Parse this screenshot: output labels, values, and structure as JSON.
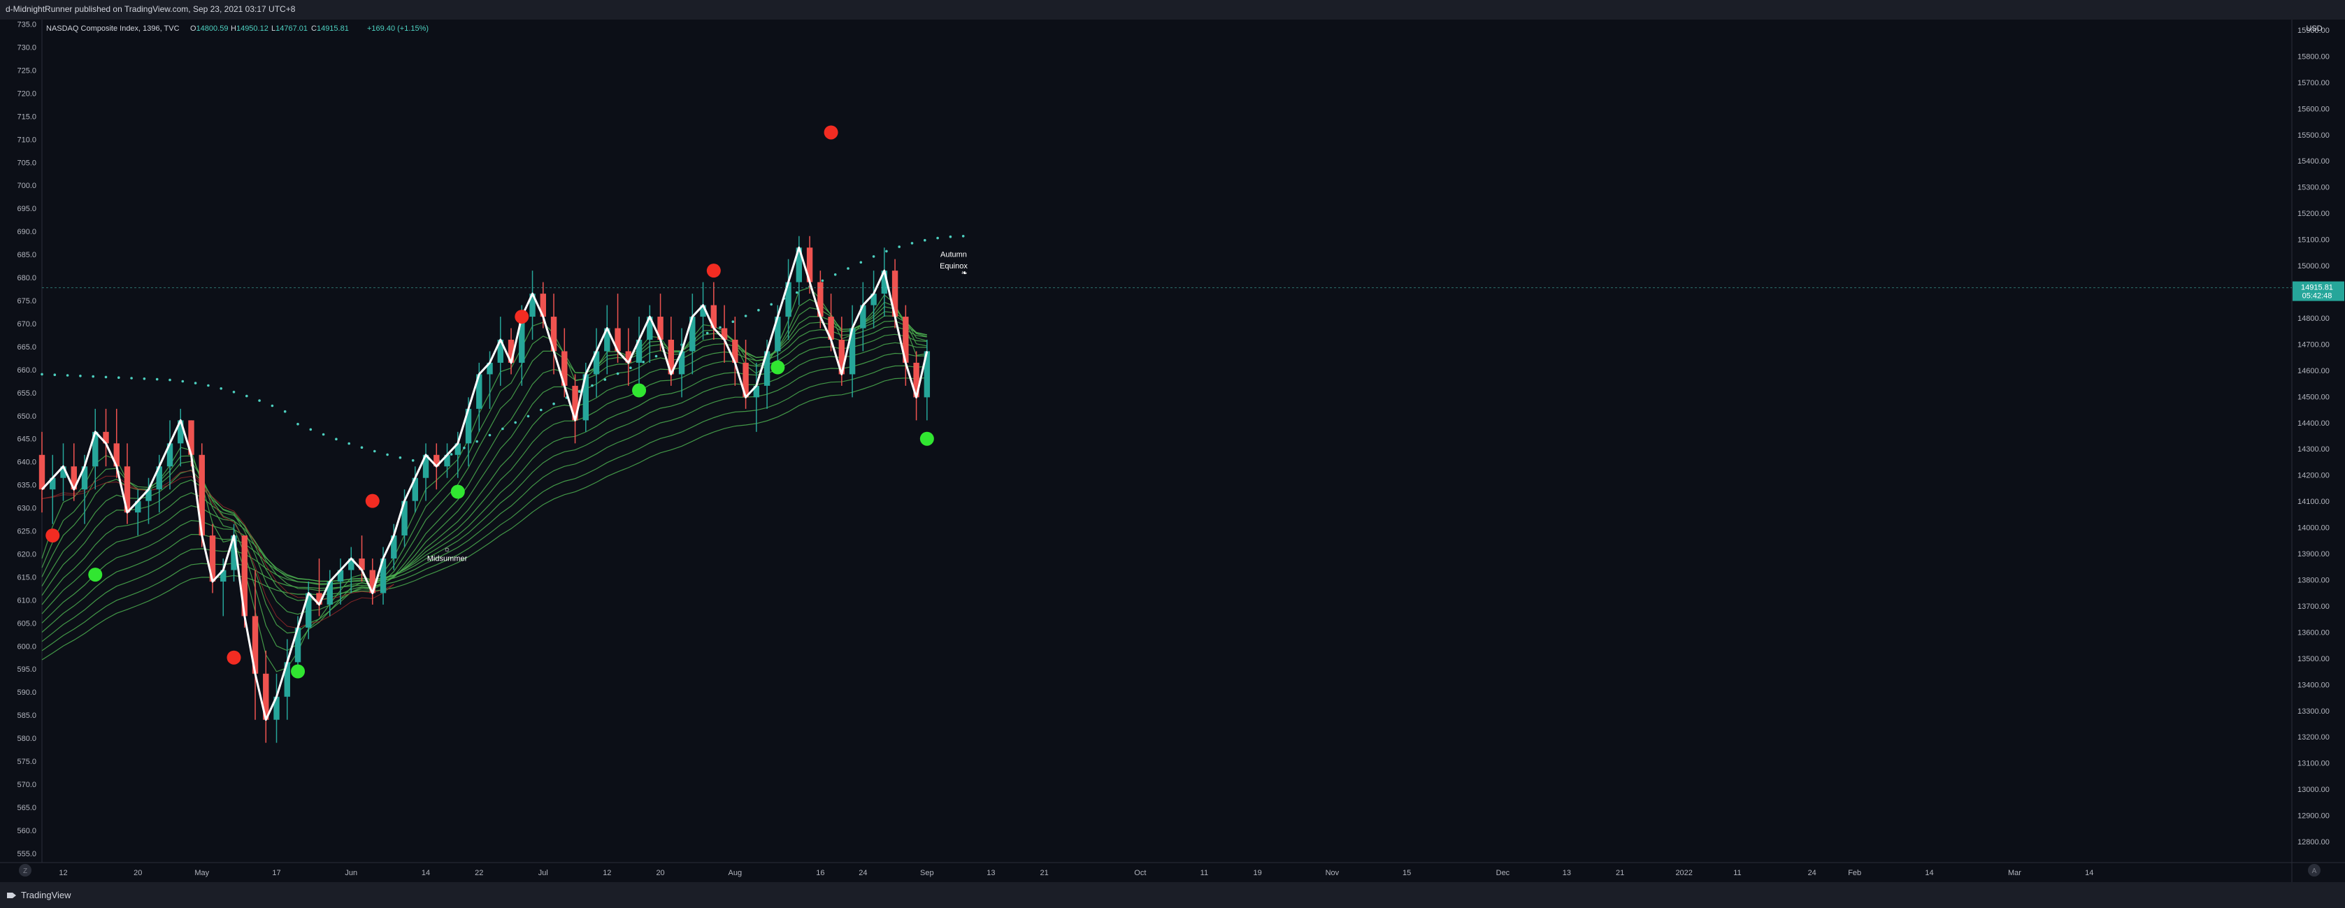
{
  "header": {
    "publisher": "d-MidnightRunner published on TradingView.com, Sep 23, 2021 03:17 UTC+8"
  },
  "legend": {
    "symbol": "NASDAQ Composite Index, 1396, TVC",
    "o_label": "O",
    "o": "14800.59",
    "h_label": "H",
    "h": "14950.12",
    "l_label": "L",
    "l": "14767.01",
    "c_label": "C",
    "c": "14915.81",
    "change": "+169.40 (+1.15%)"
  },
  "footer": {
    "brand": "TradingView"
  },
  "colors": {
    "bg": "#0c0f17",
    "up": "#26a69a",
    "down": "#ef5350",
    "ribbon": "#4caf50",
    "dot_green": "#31e631",
    "dot_red": "#f22c22",
    "accent": "#4dd0c0"
  },
  "chart_data": {
    "type": "line",
    "left_axis": {
      "ticks": [
        "735.0",
        "730.0",
        "725.0",
        "720.0",
        "715.0",
        "710.0",
        "705.0",
        "700.0",
        "695.0",
        "690.0",
        "685.0",
        "680.0",
        "675.0",
        "670.0",
        "665.0",
        "660.0",
        "655.0",
        "650.0",
        "645.0",
        "640.0",
        "635.0",
        "630.0",
        "625.0",
        "620.0",
        "615.0",
        "610.0",
        "605.0",
        "600.0",
        "595.0",
        "590.0",
        "585.0",
        "580.0",
        "575.0",
        "570.0",
        "565.0",
        "560.0",
        "555.0"
      ],
      "ylim": [
        553,
        736
      ]
    },
    "right_axis": {
      "unit": "USD",
      "ticks": [
        "15900.00",
        "15800.00",
        "15700.00",
        "15600.00",
        "15500.00",
        "15400.00",
        "15300.00",
        "15200.00",
        "15100.00",
        "15000.00",
        "14900.00",
        "14800.00",
        "14700.00",
        "14600.00",
        "14500.00",
        "14400.00",
        "14300.00",
        "14200.00",
        "14100.00",
        "14000.00",
        "13900.00",
        "13800.00",
        "13700.00",
        "13600.00",
        "13500.00",
        "13400.00",
        "13300.00",
        "13200.00",
        "13100.00",
        "13000.00",
        "12900.00",
        "12800.00"
      ],
      "ylim": [
        12720,
        15940
      ],
      "last_price": "14915.81",
      "countdown": "05:42:48"
    },
    "x_axis": {
      "labels": [
        "12",
        "20",
        "May",
        "17",
        "Jun",
        "14",
        "22",
        "Jul",
        "12",
        "20",
        "Aug",
        "16",
        "24",
        "Sep",
        "13",
        "21",
        "Oct",
        "11",
        "19",
        "Nov",
        "15",
        "Dec",
        "13",
        "21",
        "2022",
        "11",
        "24",
        "Feb",
        "14",
        "Mar",
        "14"
      ],
      "positions": [
        -1,
        6,
        12,
        19,
        26,
        33,
        38,
        44,
        50,
        55,
        62,
        70,
        74,
        80,
        86,
        91,
        100,
        106,
        111,
        118,
        125,
        134,
        140,
        145,
        151,
        156,
        163,
        167,
        174,
        182,
        189
      ]
    },
    "x_range": [
      -3,
      208
    ],
    "candles": [
      [
        -3,
        15,
        17,
        10,
        12
      ],
      [
        -2,
        12,
        15,
        9,
        13
      ],
      [
        -1,
        13,
        16,
        11,
        14
      ],
      [
        0,
        14,
        16,
        11,
        12
      ],
      [
        1,
        12,
        15,
        9,
        14
      ],
      [
        2,
        14,
        19,
        12,
        17
      ],
      [
        3,
        17,
        19,
        14,
        16
      ],
      [
        4,
        16,
        19,
        13,
        14
      ],
      [
        5,
        14,
        16,
        9,
        10
      ],
      [
        6,
        10,
        12,
        8,
        11
      ],
      [
        7,
        11,
        13,
        9,
        12
      ],
      [
        8,
        12,
        15,
        10,
        14
      ],
      [
        9,
        14,
        18,
        12,
        16
      ],
      [
        10,
        16,
        19,
        14,
        18
      ],
      [
        11,
        18,
        18,
        14,
        15
      ],
      [
        12,
        15,
        16,
        7,
        8
      ],
      [
        13,
        8,
        9,
        3,
        4
      ],
      [
        14,
        4,
        6,
        1,
        5
      ],
      [
        15,
        5,
        9,
        4,
        8
      ],
      [
        16,
        8,
        8,
        0,
        1
      ],
      [
        17,
        1,
        5,
        -8,
        -4
      ],
      [
        18,
        -4,
        -2,
        -10,
        -8
      ],
      [
        19,
        -8,
        -4,
        -10,
        -6
      ],
      [
        20,
        -6,
        -1,
        -8,
        -3
      ],
      [
        21,
        -3,
        1,
        -4,
        0
      ],
      [
        22,
        0,
        4,
        -1,
        3
      ],
      [
        23,
        3,
        6,
        1,
        2
      ],
      [
        24,
        2,
        5,
        1,
        4
      ],
      [
        25,
        4,
        6,
        2,
        5
      ],
      [
        26,
        5,
        7,
        3,
        6
      ],
      [
        27,
        6,
        8,
        4,
        5
      ],
      [
        28,
        5,
        6,
        2,
        3
      ],
      [
        29,
        3,
        7,
        2,
        6
      ],
      [
        30,
        6,
        9,
        5,
        8
      ],
      [
        31,
        8,
        12,
        7,
        11
      ],
      [
        32,
        11,
        14,
        10,
        13
      ],
      [
        33,
        13,
        16,
        11,
        15
      ],
      [
        34,
        15,
        16,
        12,
        14
      ],
      [
        35,
        14,
        16,
        13,
        15
      ],
      [
        36,
        15,
        17,
        13,
        16
      ],
      [
        37,
        16,
        20,
        14,
        19
      ],
      [
        38,
        19,
        23,
        17,
        22
      ],
      [
        39,
        22,
        24,
        19,
        23
      ],
      [
        40,
        23,
        27,
        21,
        25
      ],
      [
        41,
        25,
        26,
        22,
        23
      ],
      [
        42,
        23,
        28,
        21,
        27
      ],
      [
        43,
        27,
        31,
        25,
        29
      ],
      [
        44,
        29,
        30,
        26,
        27
      ],
      [
        45,
        27,
        29,
        22,
        24
      ],
      [
        46,
        24,
        26,
        20,
        21
      ],
      [
        47,
        21,
        22,
        16,
        18
      ],
      [
        48,
        18,
        23,
        17,
        22
      ],
      [
        49,
        22,
        26,
        20,
        24
      ],
      [
        50,
        24,
        28,
        22,
        26
      ],
      [
        51,
        26,
        29,
        23,
        24
      ],
      [
        52,
        24,
        26,
        21,
        23
      ],
      [
        53,
        23,
        27,
        21,
        25
      ],
      [
        54,
        25,
        28,
        23,
        27
      ],
      [
        55,
        27,
        29,
        24,
        25
      ],
      [
        56,
        25,
        27,
        21,
        22
      ],
      [
        57,
        22,
        26,
        20,
        24
      ],
      [
        58,
        24,
        29,
        22,
        27
      ],
      [
        59,
        27,
        30,
        25,
        28
      ],
      [
        60,
        28,
        30,
        25,
        26
      ],
      [
        61,
        26,
        28,
        23,
        25
      ],
      [
        62,
        25,
        27,
        21,
        23
      ],
      [
        63,
        23,
        25,
        19,
        20
      ],
      [
        64,
        20,
        23,
        17,
        21
      ],
      [
        65,
        21,
        25,
        19,
        24
      ],
      [
        66,
        24,
        28,
        22,
        27
      ],
      [
        67,
        27,
        32,
        25,
        30
      ],
      [
        68,
        30,
        34,
        28,
        33
      ],
      [
        69,
        33,
        34,
        29,
        30
      ],
      [
        70,
        30,
        31,
        26,
        27
      ],
      [
        71,
        27,
        29,
        24,
        25
      ],
      [
        72,
        25,
        27,
        21,
        22
      ],
      [
        73,
        22,
        28,
        20,
        26
      ],
      [
        74,
        26,
        30,
        24,
        28
      ],
      [
        75,
        28,
        31,
        26,
        29
      ],
      [
        76,
        29,
        33,
        27,
        31
      ],
      [
        77,
        31,
        32,
        26,
        27
      ],
      [
        78,
        27,
        28,
        21,
        23
      ],
      [
        79,
        23,
        24,
        18,
        20
      ],
      [
        80,
        20,
        25,
        18,
        24
      ]
    ],
    "close_line": [
      [
        -3,
        12
      ],
      [
        -2,
        13
      ],
      [
        -1,
        14
      ],
      [
        0,
        12
      ],
      [
        1,
        14
      ],
      [
        2,
        17
      ],
      [
        3,
        16
      ],
      [
        4,
        14
      ],
      [
        5,
        10
      ],
      [
        6,
        11
      ],
      [
        7,
        12
      ],
      [
        8,
        14
      ],
      [
        9,
        16
      ],
      [
        10,
        18
      ],
      [
        11,
        15
      ],
      [
        12,
        8
      ],
      [
        13,
        4
      ],
      [
        14,
        5
      ],
      [
        15,
        8
      ],
      [
        16,
        1
      ],
      [
        17,
        -4
      ],
      [
        18,
        -8
      ],
      [
        19,
        -6
      ],
      [
        20,
        -3
      ],
      [
        21,
        0
      ],
      [
        22,
        3
      ],
      [
        23,
        2
      ],
      [
        24,
        4
      ],
      [
        25,
        5
      ],
      [
        26,
        6
      ],
      [
        27,
        5
      ],
      [
        28,
        3
      ],
      [
        29,
        6
      ],
      [
        30,
        8
      ],
      [
        31,
        11
      ],
      [
        32,
        13
      ],
      [
        33,
        15
      ],
      [
        34,
        14
      ],
      [
        35,
        15
      ],
      [
        36,
        16
      ],
      [
        37,
        19
      ],
      [
        38,
        22
      ],
      [
        39,
        23
      ],
      [
        40,
        25
      ],
      [
        41,
        23
      ],
      [
        42,
        27
      ],
      [
        43,
        29
      ],
      [
        44,
        27
      ],
      [
        45,
        24
      ],
      [
        46,
        21
      ],
      [
        47,
        18
      ],
      [
        48,
        22
      ],
      [
        49,
        24
      ],
      [
        50,
        26
      ],
      [
        51,
        24
      ],
      [
        52,
        23
      ],
      [
        53,
        25
      ],
      [
        54,
        27
      ],
      [
        55,
        25
      ],
      [
        56,
        22
      ],
      [
        57,
        24
      ],
      [
        58,
        27
      ],
      [
        59,
        28
      ],
      [
        60,
        26
      ],
      [
        61,
        25
      ],
      [
        62,
        23
      ],
      [
        63,
        20
      ],
      [
        64,
        21
      ],
      [
        65,
        24
      ],
      [
        66,
        27
      ],
      [
        67,
        30
      ],
      [
        68,
        33
      ],
      [
        69,
        30
      ],
      [
        70,
        27
      ],
      [
        71,
        25
      ],
      [
        72,
        22
      ],
      [
        73,
        26
      ],
      [
        74,
        28
      ],
      [
        75,
        29
      ],
      [
        76,
        31
      ],
      [
        77,
        27
      ],
      [
        78,
        23
      ],
      [
        79,
        20
      ],
      [
        80,
        24
      ]
    ],
    "red_dots": [
      [
        -2,
        624.0
      ],
      [
        15,
        597.5
      ],
      [
        28,
        631.5
      ],
      [
        42,
        671.5
      ],
      [
        60,
        681.5
      ],
      [
        71,
        711.5
      ]
    ],
    "green_dots": [
      [
        2,
        615.5
      ],
      [
        21,
        594.5
      ],
      [
        36,
        633.5
      ],
      [
        53,
        655.5
      ],
      [
        66,
        660.5
      ],
      [
        80,
        645.0
      ]
    ],
    "annotations": [
      {
        "label": "Midsummer",
        "x": 35,
        "y": 618.5
      },
      {
        "label": "Autumn",
        "x": 82.5,
        "y": 684.5
      },
      {
        "label": "Equinox",
        "x": 82.5,
        "y": 682.0
      }
    ]
  }
}
